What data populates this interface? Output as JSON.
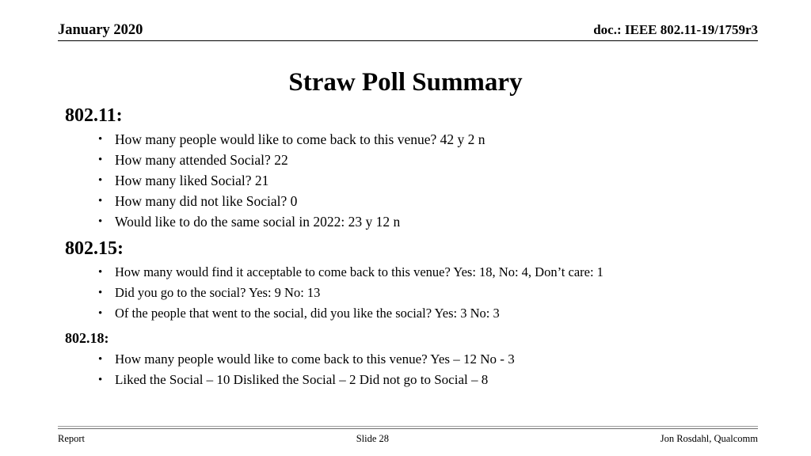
{
  "header": {
    "date": "January 2020",
    "doc_reference": "doc.: IEEE 802.11-19/1759r3"
  },
  "title": "Straw Poll Summary",
  "sections": [
    {
      "heading": "802.11:",
      "bullets": [
        "How many people would like to come back to this venue? 42 y 2 n",
        "How many attended Social?  22",
        "How many liked Social? 21",
        "How many did not like Social? 0",
        "Would like to do the same social in 2022: 23 y 12 n"
      ]
    },
    {
      "heading": "802.15:",
      "bullets": [
        "How many would find it acceptable to come back to this venue?  Yes: 18, No: 4, Don’t care: 1",
        "Did you go to the social?  Yes: 9 No: 13",
        "Of the people that went to the social, did you like the social?  Yes: 3  No: 3"
      ]
    },
    {
      "heading": "802.18:",
      "bullets": [
        "How many people would like to come back to this venue?   Yes – 12  No -  3",
        "Liked the Social – 10    Disliked the Social – 2    Did not go to Social – 8"
      ]
    }
  ],
  "bullet_glyph": "•",
  "footer": {
    "left": "Report",
    "center": "Slide 28",
    "right": "Jon Rosdahl, Qualcomm"
  }
}
